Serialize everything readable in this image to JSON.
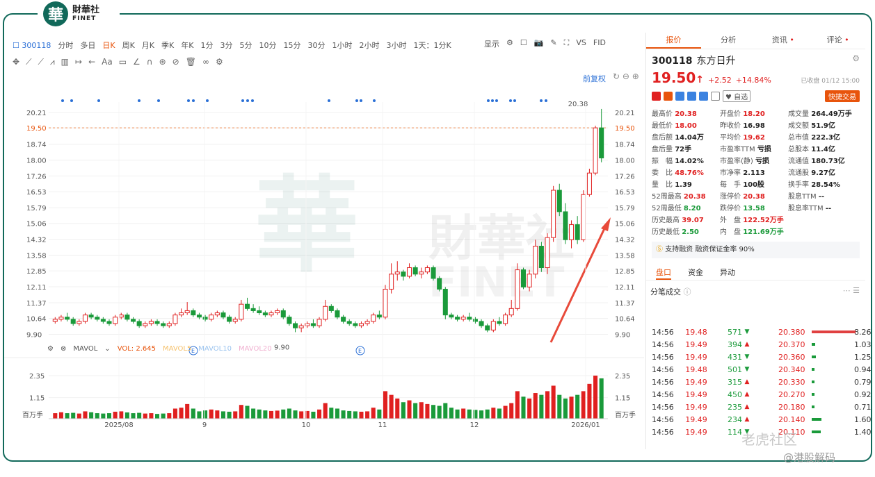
{
  "brand": {
    "seal": "華",
    "cn": "財華社",
    "en": "FINET"
  },
  "toolbar": {
    "code": "300118",
    "items": [
      "分时",
      "多日",
      "日K",
      "周K",
      "月K",
      "季K",
      "年K",
      "1分",
      "3分",
      "5分",
      "10分",
      "15分",
      "30分",
      "1小时",
      "2小时",
      "3小时",
      "1天：1分K"
    ],
    "active": "日K",
    "right": [
      "显示",
      "VS",
      "FID"
    ]
  },
  "drawing_tools": [
    "✥",
    "⟋",
    "⟋",
    "⩘",
    "▥",
    "↦",
    "←",
    "Aa",
    "▭",
    "∠",
    "∩",
    "⊛",
    "⊘",
    "🗑",
    "∞",
    "⚙"
  ],
  "chart_controls": {
    "fq": "前复权"
  },
  "chart_data": {
    "type": "candlestick",
    "y_ticks": [
      "20.21",
      "19.50",
      "18.74",
      "18.00",
      "17.26",
      "16.53",
      "15.79",
      "15.06",
      "14.32",
      "13.58",
      "12.85",
      "12.11",
      "11.37",
      "10.64",
      "9.90"
    ],
    "x_ticks": [
      "2025/08",
      "9",
      "10",
      "11",
      "12",
      "2026/01"
    ],
    "current": "19.50",
    "high_label": "20.38",
    "low_label": "9.90",
    "ohlc": [
      [
        10.5,
        10.7,
        10.4,
        10.6
      ],
      [
        10.6,
        10.8,
        10.5,
        10.7
      ],
      [
        10.7,
        10.9,
        10.5,
        10.6
      ],
      [
        10.6,
        10.7,
        10.3,
        10.4
      ],
      [
        10.4,
        10.6,
        10.3,
        10.5
      ],
      [
        10.5,
        10.9,
        10.4,
        10.8
      ],
      [
        10.8,
        10.9,
        10.6,
        10.7
      ],
      [
        10.7,
        10.8,
        10.5,
        10.6
      ],
      [
        10.6,
        10.7,
        10.4,
        10.5
      ],
      [
        10.5,
        10.6,
        10.3,
        10.4
      ],
      [
        10.4,
        10.8,
        10.3,
        10.7
      ],
      [
        10.7,
        10.9,
        10.6,
        10.8
      ],
      [
        10.8,
        10.9,
        10.5,
        10.6
      ],
      [
        10.6,
        10.7,
        10.4,
        10.5
      ],
      [
        10.5,
        10.6,
        10.2,
        10.3
      ],
      [
        10.3,
        10.5,
        10.2,
        10.4
      ],
      [
        10.4,
        10.6,
        10.3,
        10.5
      ],
      [
        10.5,
        10.6,
        10.3,
        10.4
      ],
      [
        10.4,
        10.5,
        10.2,
        10.3
      ],
      [
        10.3,
        10.5,
        10.2,
        10.4
      ],
      [
        10.4,
        10.9,
        10.3,
        10.8
      ],
      [
        10.8,
        11.1,
        10.7,
        10.9
      ],
      [
        10.9,
        11.4,
        10.8,
        11.0
      ],
      [
        11.0,
        11.1,
        10.7,
        10.8
      ],
      [
        10.8,
        10.9,
        10.6,
        10.7
      ],
      [
        10.7,
        10.8,
        10.5,
        10.6
      ],
      [
        10.6,
        10.9,
        10.5,
        10.8
      ],
      [
        10.8,
        11.0,
        10.7,
        10.9
      ],
      [
        10.9,
        11.0,
        10.6,
        10.7
      ],
      [
        10.7,
        10.8,
        10.4,
        10.5
      ],
      [
        10.5,
        10.7,
        10.4,
        10.6
      ],
      [
        10.6,
        11.5,
        10.5,
        11.3
      ],
      [
        11.3,
        11.6,
        11.0,
        11.1
      ],
      [
        11.1,
        11.3,
        10.9,
        11.0
      ],
      [
        11.0,
        11.2,
        10.8,
        10.9
      ],
      [
        10.9,
        11.0,
        10.7,
        10.8
      ],
      [
        10.8,
        11.0,
        10.7,
        10.9
      ],
      [
        10.9,
        11.1,
        10.8,
        11.0
      ],
      [
        11.0,
        11.1,
        10.6,
        10.7
      ],
      [
        10.7,
        10.8,
        10.3,
        10.4
      ],
      [
        10.4,
        10.5,
        10.0,
        10.2
      ],
      [
        10.2,
        10.4,
        10.0,
        10.3
      ],
      [
        10.3,
        10.5,
        10.2,
        10.4
      ],
      [
        10.4,
        10.6,
        10.2,
        10.3
      ],
      [
        10.3,
        10.7,
        10.2,
        10.6
      ],
      [
        10.6,
        11.5,
        10.5,
        11.2
      ],
      [
        11.2,
        11.3,
        10.9,
        11.0
      ],
      [
        11.0,
        11.1,
        10.6,
        10.7
      ],
      [
        10.7,
        10.8,
        10.4,
        10.5
      ],
      [
        10.5,
        10.6,
        10.3,
        10.4
      ],
      [
        10.4,
        10.5,
        10.2,
        10.3
      ],
      [
        10.3,
        10.5,
        10.2,
        10.4
      ],
      [
        10.4,
        10.6,
        10.3,
        10.5
      ],
      [
        10.5,
        10.9,
        10.4,
        10.8
      ],
      [
        10.8,
        11.0,
        10.6,
        10.7
      ],
      [
        10.7,
        12.2,
        10.6,
        12.0
      ],
      [
        12.0,
        13.2,
        11.8,
        12.7
      ],
      [
        12.7,
        13.3,
        12.4,
        12.8
      ],
      [
        12.8,
        12.9,
        12.4,
        12.6
      ],
      [
        12.6,
        13.2,
        12.5,
        13.0
      ],
      [
        13.0,
        13.1,
        12.6,
        12.7
      ],
      [
        12.7,
        13.0,
        12.5,
        12.8
      ],
      [
        12.8,
        13.1,
        12.7,
        13.0
      ],
      [
        13.0,
        13.1,
        12.4,
        12.5
      ],
      [
        12.5,
        12.6,
        11.9,
        12.0
      ],
      [
        12.0,
        12.1,
        10.6,
        10.8
      ],
      [
        10.8,
        10.9,
        10.6,
        10.7
      ],
      [
        10.7,
        10.8,
        10.5,
        10.6
      ],
      [
        10.6,
        10.8,
        10.5,
        10.7
      ],
      [
        10.7,
        10.9,
        10.5,
        10.6
      ],
      [
        10.6,
        10.7,
        10.4,
        10.5
      ],
      [
        10.5,
        10.6,
        10.2,
        10.3
      ],
      [
        10.3,
        10.4,
        10.0,
        10.1
      ],
      [
        10.1,
        10.6,
        10.0,
        10.5
      ],
      [
        10.5,
        10.7,
        10.3,
        10.4
      ],
      [
        10.4,
        10.9,
        10.3,
        10.8
      ],
      [
        10.8,
        11.5,
        10.7,
        11.1
      ],
      [
        11.1,
        13.2,
        11.0,
        12.9
      ],
      [
        12.9,
        13.0,
        12.0,
        12.1
      ],
      [
        12.1,
        12.9,
        11.9,
        12.7
      ],
      [
        12.7,
        14.3,
        12.5,
        14.0
      ],
      [
        14.0,
        14.2,
        12.8,
        13.0
      ],
      [
        13.0,
        14.6,
        12.7,
        14.4
      ],
      [
        14.4,
        16.8,
        14.2,
        16.6
      ],
      [
        16.6,
        16.9,
        15.4,
        15.6
      ],
      [
        15.6,
        16.0,
        14.1,
        14.3
      ],
      [
        14.3,
        15.2,
        13.9,
        15.0
      ],
      [
        15.0,
        15.4,
        14.1,
        14.3
      ],
      [
        14.3,
        16.6,
        14.2,
        16.4
      ],
      [
        16.4,
        17.6,
        16.3,
        17.4
      ],
      [
        17.4,
        19.6,
        17.3,
        19.5
      ],
      [
        19.5,
        20.38,
        17.9,
        18.1
      ]
    ],
    "vol_max": "2.35",
    "vol_mid": "1.15",
    "vol_unit": "百万手",
    "volumes": [
      0.3,
      0.35,
      0.3,
      0.32,
      0.28,
      0.4,
      0.35,
      0.3,
      0.28,
      0.3,
      0.38,
      0.4,
      0.34,
      0.3,
      0.32,
      0.28,
      0.3,
      0.26,
      0.28,
      0.3,
      0.55,
      0.6,
      0.8,
      0.55,
      0.4,
      0.45,
      0.5,
      0.45,
      0.4,
      0.38,
      0.4,
      0.75,
      0.7,
      0.55,
      0.5,
      0.45,
      0.42,
      0.44,
      0.5,
      0.55,
      0.45,
      0.4,
      0.42,
      0.38,
      0.5,
      0.85,
      0.6,
      0.55,
      0.45,
      0.42,
      0.4,
      0.38,
      0.4,
      0.6,
      0.5,
      1.5,
      1.3,
      1.1,
      0.9,
      1.0,
      0.85,
      0.9,
      0.8,
      0.75,
      0.7,
      0.85,
      0.6,
      0.5,
      0.55,
      0.5,
      0.48,
      0.45,
      0.5,
      0.6,
      0.55,
      0.7,
      0.85,
      1.5,
      1.2,
      1.1,
      1.4,
      1.3,
      1.5,
      1.8,
      1.3,
      1.1,
      1.2,
      1.3,
      1.5,
      1.9,
      2.35,
      2.2
    ]
  },
  "vol_indicator": {
    "name": "MAVOL",
    "vol": "VOL: 2.645",
    "ma5": "MAVOL5",
    "ma10": "MAVOL10",
    "ma20": "MAVOL20"
  },
  "right": {
    "tabs": [
      "报价",
      "分析",
      "资讯",
      "评论"
    ],
    "code": "300118",
    "name": "东方日升",
    "price": "19.50",
    "change": "+2.52",
    "pct": "+14.84%",
    "status": "已收盘 01/12 15:00",
    "watch": "自选",
    "trade": "快捷交易",
    "stats": [
      [
        "最高价",
        "20.38",
        "r",
        "开盘价",
        "18.20",
        "r",
        "成交量",
        "264.49万手",
        "k"
      ],
      [
        "最低价",
        "18.00",
        "r",
        "昨收价",
        "16.98",
        "k",
        "成交额",
        "51.9亿",
        "k"
      ],
      [
        "盘后额",
        "14.04万",
        "k",
        "平均价",
        "19.62",
        "r",
        "总市值",
        "222.3亿",
        "k"
      ],
      [
        "盘后量",
        "72手",
        "k",
        "市盈率TTM",
        "亏损",
        "k",
        "总股本",
        "11.4亿",
        "k"
      ],
      [
        "振　幅",
        "14.02%",
        "k",
        "市盈率(静)",
        "亏损",
        "k",
        "流通值",
        "180.73亿",
        "k"
      ],
      [
        "委　比",
        "48.76%",
        "r",
        "市净率",
        "2.113",
        "k",
        "流通股",
        "9.27亿",
        "k"
      ],
      [
        "量　比",
        "1.39",
        "k",
        "每　手",
        "100股",
        "k",
        "换手率",
        "28.54%",
        "k"
      ],
      [
        "52周最高",
        "20.38",
        "r",
        "涨停价",
        "20.38",
        "r",
        "股息TTM",
        "--",
        "k"
      ],
      [
        "52周最低",
        "8.20",
        "g",
        "跌停价",
        "13.58",
        "g",
        "股息率TTM",
        "--",
        "k"
      ],
      [
        "历史最高",
        "39.07",
        "r",
        "外　盘",
        "122.52万手",
        "r",
        "",
        "",
        ""
      ],
      [
        "历史最低",
        "2.50",
        "g",
        "内　盘",
        "121.69万手",
        "g",
        "",
        "",
        ""
      ]
    ],
    "margin": "支持融资 融资保证金率 90%",
    "subtabs": [
      "盘口",
      "资金",
      "异动"
    ],
    "ticks_title": "分笔成交",
    "trades": [
      [
        "14:56",
        "19.48",
        "571",
        "▼"
      ],
      [
        "14:56",
        "19.49",
        "394",
        "▲"
      ],
      [
        "14:56",
        "19.49",
        "431",
        "▼"
      ],
      [
        "14:56",
        "19.48",
        "501",
        "▼"
      ],
      [
        "14:56",
        "19.49",
        "315",
        "▲"
      ],
      [
        "14:56",
        "19.49",
        "450",
        "▲"
      ],
      [
        "14:56",
        "19.49",
        "235",
        "▲"
      ],
      [
        "14:56",
        "19.49",
        "234",
        "▲"
      ],
      [
        "14:56",
        "19.49",
        "114",
        "▼"
      ]
    ],
    "depth": [
      [
        "20.380",
        "8.26%",
        0.9
      ],
      [
        "20.370",
        "1.03%",
        0.12
      ],
      [
        "20.360",
        "1.25%",
        0.15
      ],
      [
        "20.340",
        "0.94%",
        0.1
      ],
      [
        "20.330",
        "0.79%",
        0.08
      ],
      [
        "20.270",
        "0.92%",
        0.1
      ],
      [
        "20.180",
        "0.71%",
        0.07
      ],
      [
        "20.140",
        "1.60%",
        0.2
      ],
      [
        "20.110",
        "1.40%",
        0.18
      ]
    ]
  },
  "watermark": {
    "a": "老虎社区",
    "b": "@港股解码"
  }
}
